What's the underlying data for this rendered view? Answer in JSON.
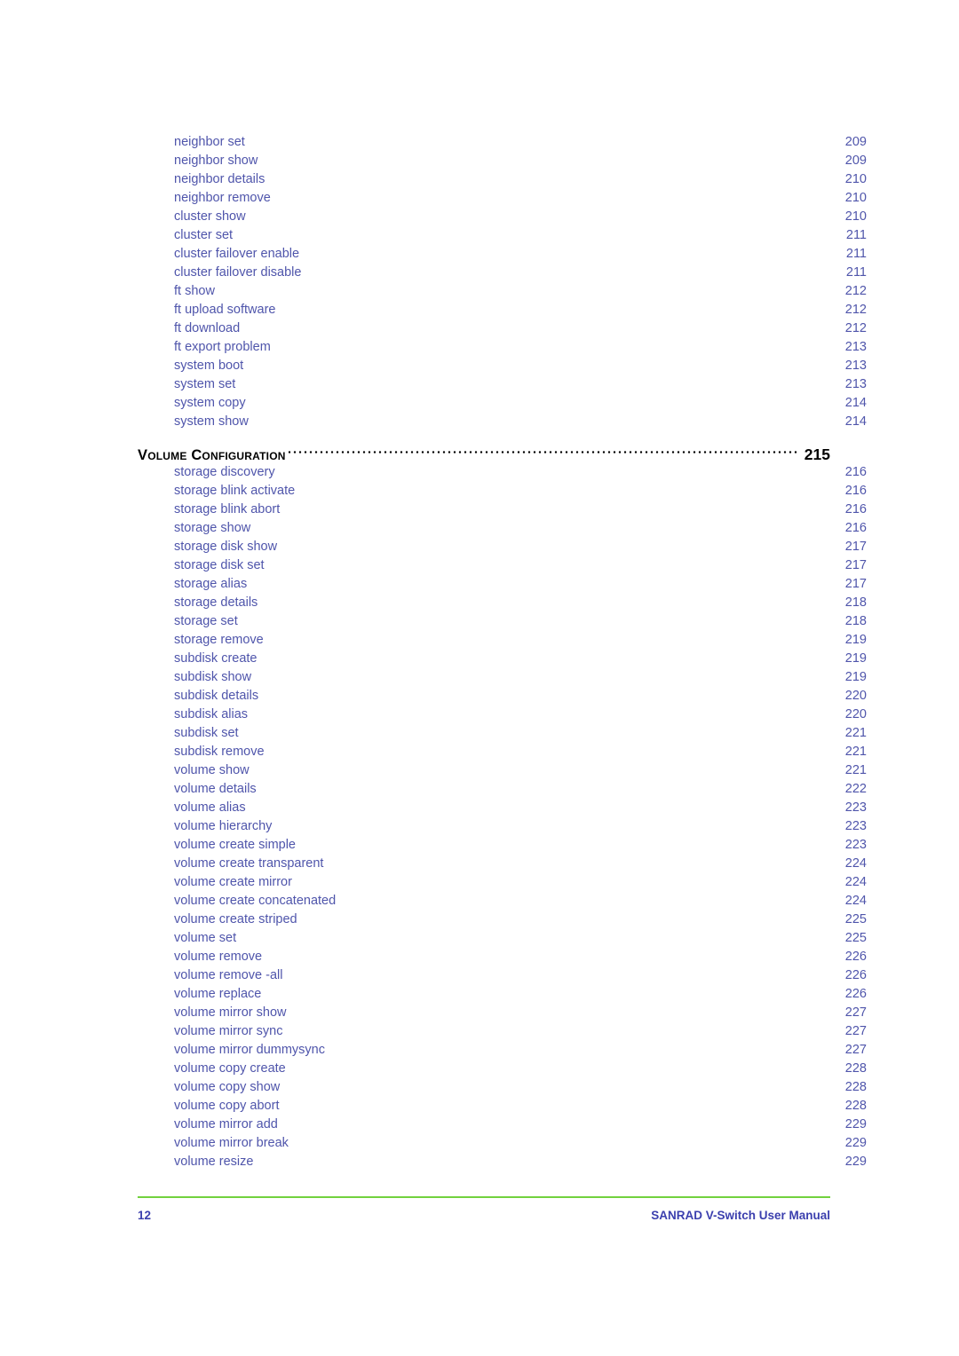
{
  "document": {
    "type": "table-of-contents"
  },
  "colors": {
    "entry_text": "#4f55ab",
    "heading_text": "#000000",
    "footer_text": "#3b3fae",
    "footer_rule": "#72d13d",
    "page_background": "#ffffff"
  },
  "toc": {
    "entries": [
      {
        "level": 2,
        "label": "neighbor set",
        "page": "209"
      },
      {
        "level": 2,
        "label": "neighbor show",
        "page": "209"
      },
      {
        "level": 2,
        "label": "neighbor details",
        "page": "210"
      },
      {
        "level": 2,
        "label": "neighbor remove",
        "page": "210"
      },
      {
        "level": 2,
        "label": "cluster show",
        "page": "210"
      },
      {
        "level": 2,
        "label": "cluster set",
        "page": "211"
      },
      {
        "level": 2,
        "label": "cluster failover enable",
        "page": "211"
      },
      {
        "level": 2,
        "label": "cluster failover disable",
        "page": "211"
      },
      {
        "level": 2,
        "label": "ft show",
        "page": "212"
      },
      {
        "level": 2,
        "label": "ft upload software",
        "page": "212"
      },
      {
        "level": 2,
        "label": "ft download",
        "page": "212"
      },
      {
        "level": 2,
        "label": "ft export problem",
        "page": "213"
      },
      {
        "level": 2,
        "label": "system boot",
        "page": "213"
      },
      {
        "level": 2,
        "label": "system set",
        "page": "213"
      },
      {
        "level": 2,
        "label": "system copy",
        "page": "214"
      },
      {
        "level": 2,
        "label": "system show",
        "page": "214"
      },
      {
        "level": 1,
        "label": "Volume Configuration",
        "page": "215"
      },
      {
        "level": 2,
        "label": "storage discovery",
        "page": "216"
      },
      {
        "level": 2,
        "label": "storage blink activate",
        "page": "216"
      },
      {
        "level": 2,
        "label": "storage blink abort",
        "page": "216"
      },
      {
        "level": 2,
        "label": "storage show",
        "page": "216"
      },
      {
        "level": 2,
        "label": "storage disk show",
        "page": "217"
      },
      {
        "level": 2,
        "label": "storage disk set",
        "page": "217"
      },
      {
        "level": 2,
        "label": "storage alias",
        "page": "217"
      },
      {
        "level": 2,
        "label": "storage details",
        "page": "218"
      },
      {
        "level": 2,
        "label": "storage set",
        "page": "218"
      },
      {
        "level": 2,
        "label": "storage remove",
        "page": "219"
      },
      {
        "level": 2,
        "label": "subdisk create",
        "page": "219"
      },
      {
        "level": 2,
        "label": "subdisk show",
        "page": "219"
      },
      {
        "level": 2,
        "label": "subdisk details",
        "page": "220"
      },
      {
        "level": 2,
        "label": "subdisk alias",
        "page": "220"
      },
      {
        "level": 2,
        "label": "subdisk set",
        "page": "221"
      },
      {
        "level": 2,
        "label": "subdisk remove",
        "page": "221"
      },
      {
        "level": 2,
        "label": "volume show",
        "page": "221"
      },
      {
        "level": 2,
        "label": "volume details",
        "page": "222"
      },
      {
        "level": 2,
        "label": "volume alias",
        "page": "223"
      },
      {
        "level": 2,
        "label": "volume hierarchy",
        "page": "223"
      },
      {
        "level": 2,
        "label": "volume create simple",
        "page": "223"
      },
      {
        "level": 2,
        "label": "volume create transparent",
        "page": "224"
      },
      {
        "level": 2,
        "label": "volume create mirror",
        "page": "224"
      },
      {
        "level": 2,
        "label": "volume create concatenated",
        "page": "224"
      },
      {
        "level": 2,
        "label": "volume create striped",
        "page": "225"
      },
      {
        "level": 2,
        "label": "volume set",
        "page": "225"
      },
      {
        "level": 2,
        "label": "volume remove",
        "page": "226"
      },
      {
        "level": 2,
        "label": "volume remove -all",
        "page": "226"
      },
      {
        "level": 2,
        "label": "volume replace",
        "page": "226"
      },
      {
        "level": 2,
        "label": "volume mirror show",
        "page": "227"
      },
      {
        "level": 2,
        "label": "volume mirror sync",
        "page": "227"
      },
      {
        "level": 2,
        "label": "volume mirror dummysync",
        "page": "227"
      },
      {
        "level": 2,
        "label": "volume copy create",
        "page": "228"
      },
      {
        "level": 2,
        "label": "volume copy show",
        "page": "228"
      },
      {
        "level": 2,
        "label": "volume copy abort",
        "page": "228"
      },
      {
        "level": 2,
        "label": "volume mirror add",
        "page": "229"
      },
      {
        "level": 2,
        "label": "volume mirror break",
        "page": "229"
      },
      {
        "level": 2,
        "label": "volume resize",
        "page": "229"
      }
    ]
  },
  "footer": {
    "page_number": "12",
    "manual_title": "SANRAD V-Switch User Manual"
  }
}
